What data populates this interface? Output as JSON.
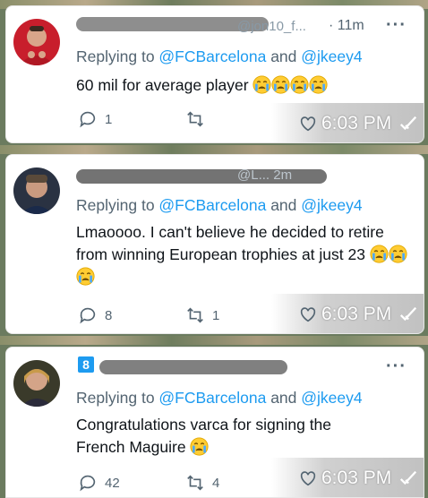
{
  "tweets": [
    {
      "handle_suffix": "@jon10_f...",
      "time": "· 11m",
      "replying_prefix": "Replying to ",
      "mention1": "@FCBarcelona",
      "and_word": " and ",
      "mention2": "@jkeey4",
      "text": "60 mil for average player",
      "emoji_count": 4,
      "reply_count": "1",
      "retweet_count": "",
      "like_count": "",
      "timestamp": "6:03 PM"
    },
    {
      "handle_suffix": "@L... 2m",
      "time": "",
      "replying_prefix": "Replying to ",
      "mention1": "@FCBarcelona",
      "and_word": " and ",
      "mention2": "@jkeey4",
      "text": "Lmaoooo. I can't believe he decided to retire from winning European trophies at just 23",
      "emoji_count": 3,
      "reply_count": "8",
      "retweet_count": "1",
      "like_count": "",
      "timestamp": "6:03 PM"
    },
    {
      "handle_suffix": "",
      "time": "",
      "badge_number": "8",
      "replying_prefix": "Replying to ",
      "mention1": "@FCBarcelona",
      "and_word": " and ",
      "mention2": "@jkeey4",
      "text": "Congratulations varca for signing the French Maguire",
      "emoji_count": 1,
      "reply_count": "42",
      "retweet_count": "4",
      "like_count": "",
      "timestamp": "6:03 PM"
    }
  ],
  "more_label": "···",
  "colors": {
    "mention": "#1d9bf0",
    "text": "#0f1419",
    "muted": "#536471"
  }
}
